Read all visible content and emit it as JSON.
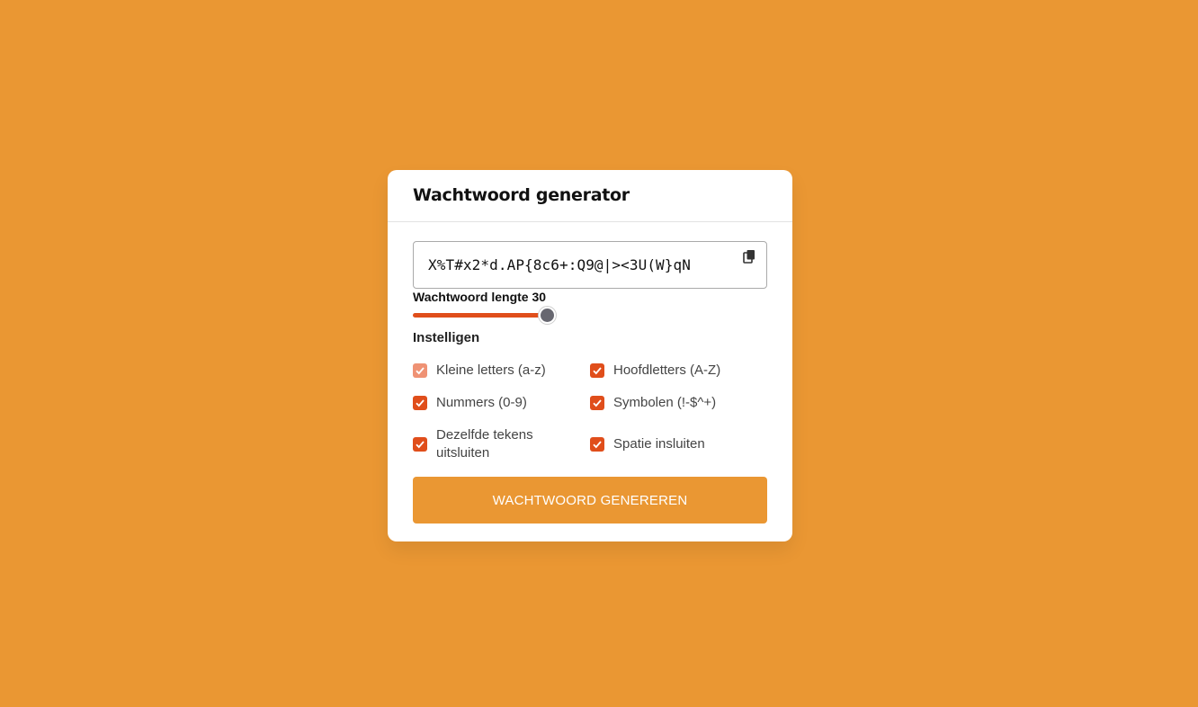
{
  "title": "Wachtwoord generator",
  "password": {
    "value": "X%T#x2*d.AP{8c6+:Q9@|><3U(W}qN",
    "copy_icon": "copy-icon"
  },
  "length": {
    "label": "Wachtwoord lengte 30",
    "value": 30
  },
  "settings": {
    "label": "Instelligen",
    "options": [
      {
        "label": "Kleine letters (a-z)",
        "checked": true,
        "disabled": true
      },
      {
        "label": "Hoofdletters (A-Z)",
        "checked": true,
        "disabled": false
      },
      {
        "label": "Nummers (0-9)",
        "checked": true,
        "disabled": false
      },
      {
        "label": "Symbolen (!-$^+)",
        "checked": true,
        "disabled": false
      },
      {
        "label": "Dezelfde tekens uitsluiten",
        "checked": true,
        "disabled": false
      },
      {
        "label": "Spatie insluiten",
        "checked": true,
        "disabled": false
      }
    ]
  },
  "button": {
    "label": "WACHTWOORD GENEREREN"
  },
  "colors": {
    "background": "#EA9733",
    "accent": "#E04E1B",
    "thumb": "#676770"
  }
}
